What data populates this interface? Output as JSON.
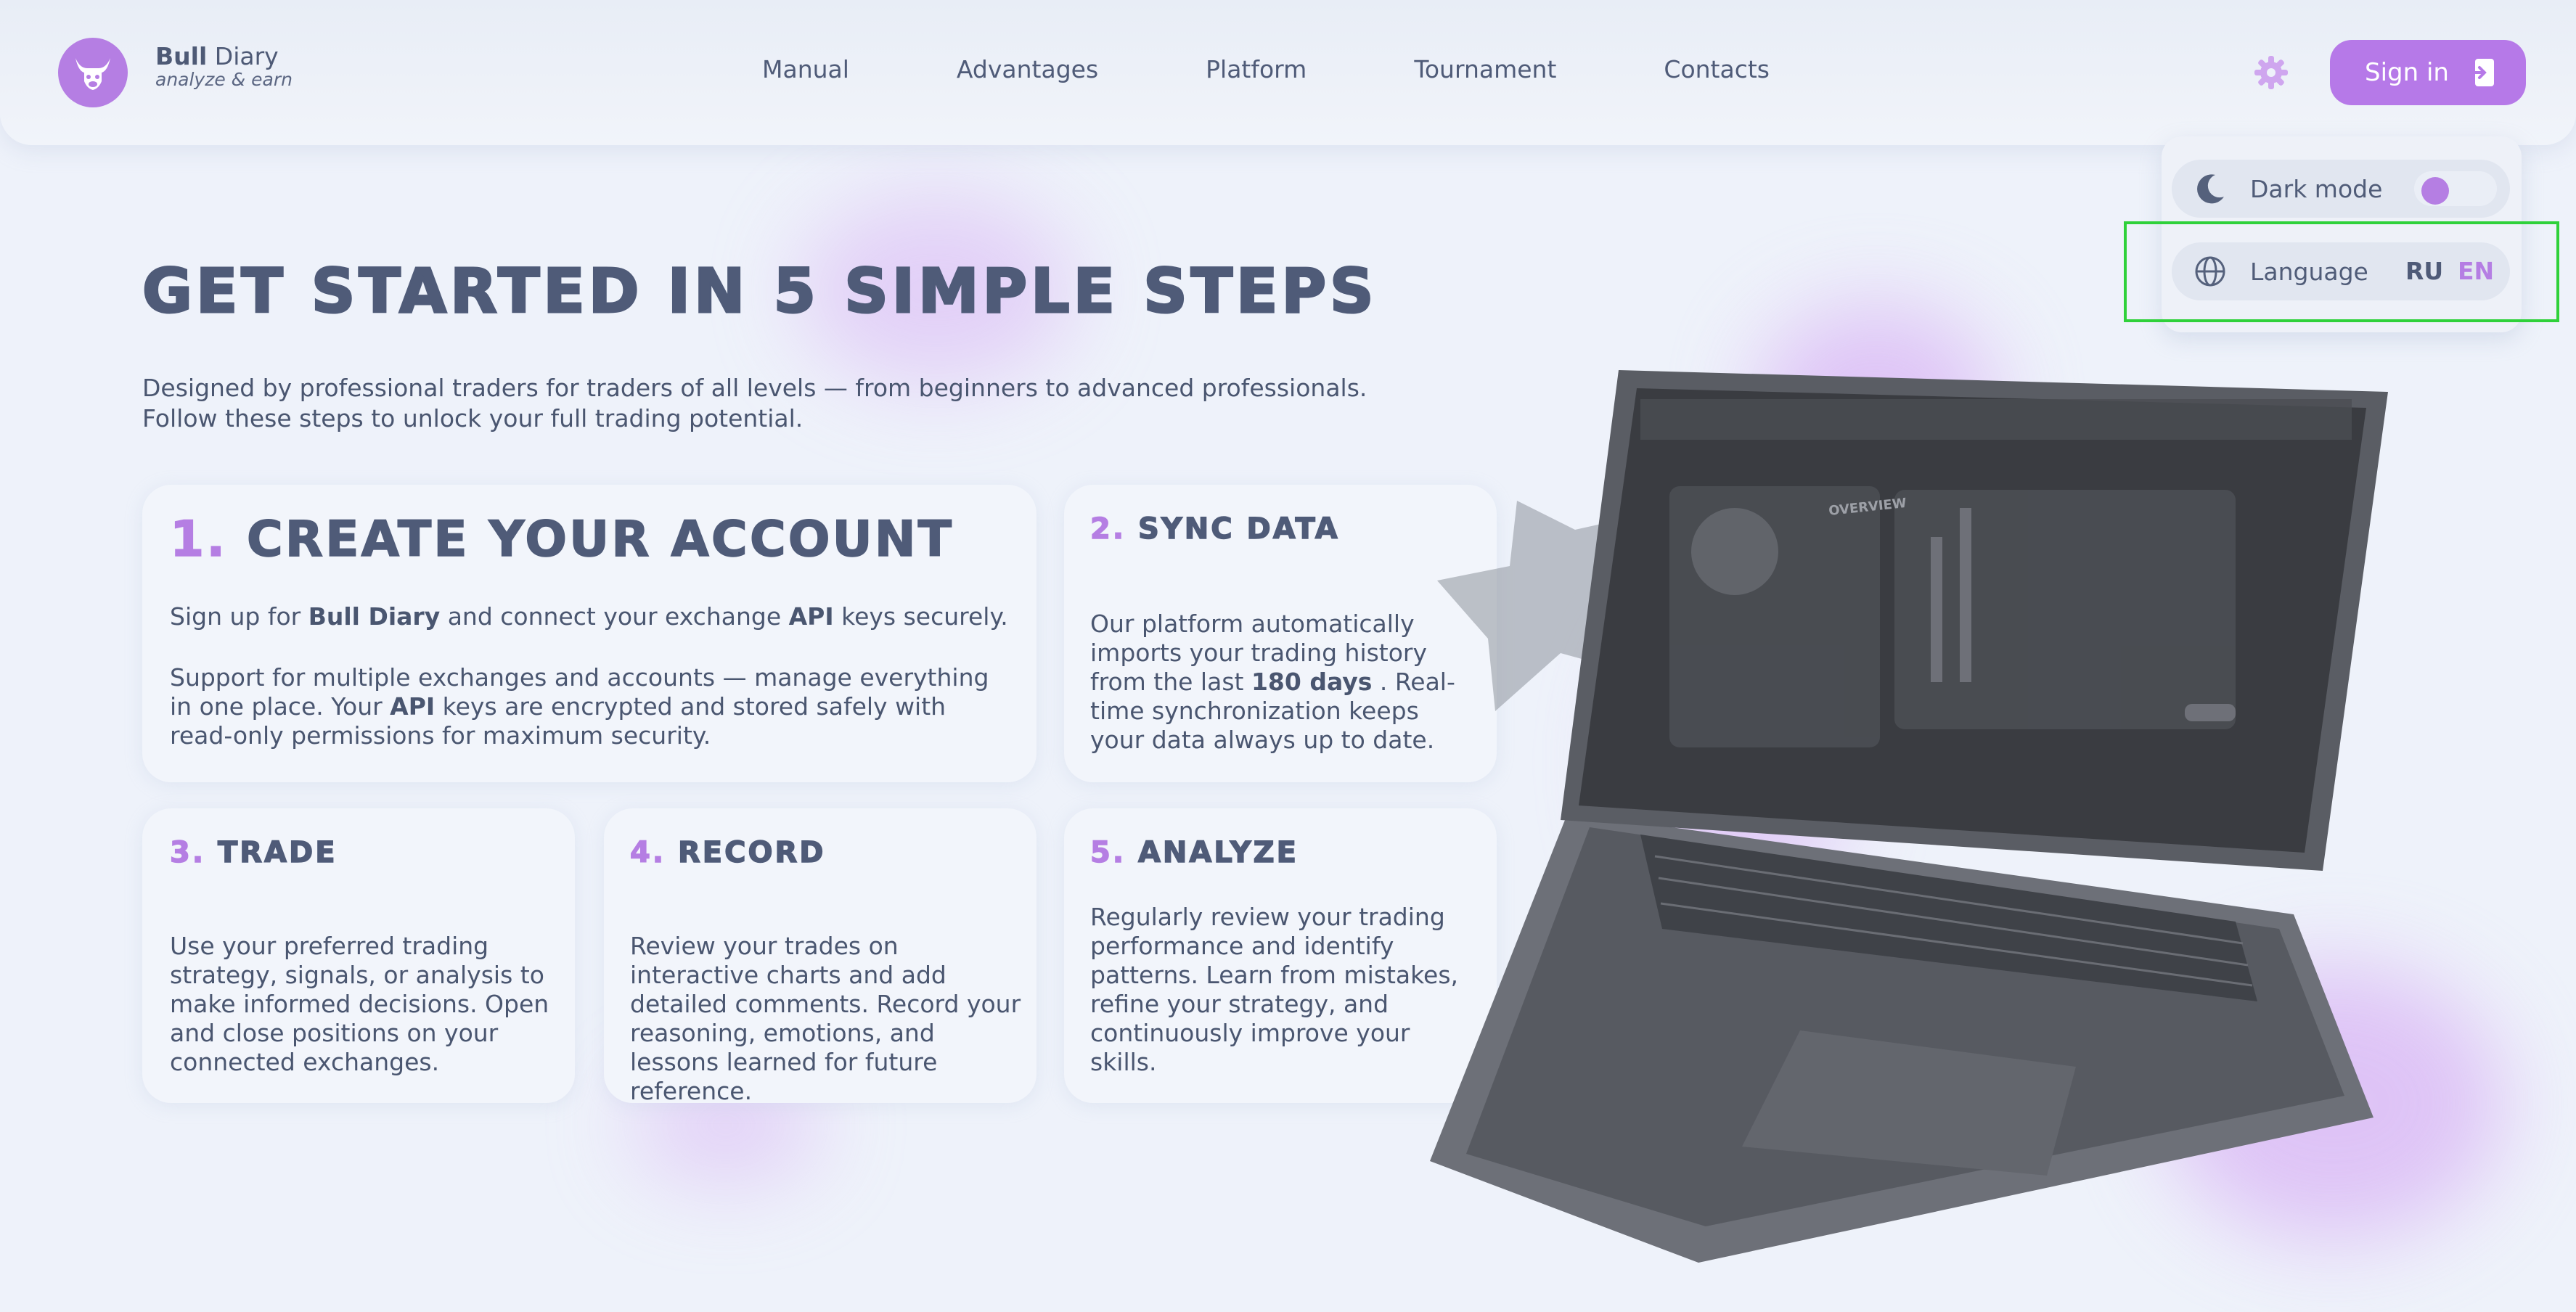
{
  "header": {
    "brand_bold": "Bull",
    "brand_rest": "Diary",
    "tagline": "analyze & earn",
    "nav": [
      "Manual",
      "Advantages",
      "Platform",
      "Tournament",
      "Contacts"
    ],
    "sign_in": "Sign in"
  },
  "settings": {
    "dark_mode_label": "Dark mode",
    "dark_mode_on": true,
    "language_label": "Language",
    "lang_ru": "RU",
    "lang_en": "EN",
    "active_language": "EN"
  },
  "hero": {
    "title": "GET STARTED IN 5 SIMPLE STEPS",
    "subtitle_line1": "Designed by professional traders for traders of all levels — from beginners to advanced professionals.",
    "subtitle_line2": "Follow these steps to unlock your full trading potential."
  },
  "steps": {
    "s1": {
      "num": "1.",
      "title": "CREATE YOUR ACCOUNT",
      "p1_a": "Sign up for ",
      "p1_b": "Bull Diary",
      "p1_c": " and connect your exchange ",
      "p1_d": "API",
      "p1_e": " keys securely.",
      "p2_a": "Support for multiple exchanges and accounts — manage everything in one place. Your ",
      "p2_b": "API",
      "p2_c": " keys are encrypted and stored safely with read-only permissions for maximum security."
    },
    "s2": {
      "num": "2.",
      "title": "SYNC DATA",
      "t_a": "Our platform automatically imports your trading history from the last ",
      "t_b": "180 days",
      "t_c": " . Real-time synchronization keeps your data always up to date."
    },
    "s3": {
      "num": "3.",
      "title": "TRADE",
      "text": "Use your preferred trading strategy, signals, or analysis to make informed decisions. Open and close positions on your connected exchanges."
    },
    "s4": {
      "num": "4.",
      "title": "RECORD",
      "text": "Review your trades on interactive charts and add detailed comments. Record your reasoning, emotions, and lessons learned for future reference."
    },
    "s5": {
      "num": "5.",
      "title": "ANALYZE",
      "text": "Regularly review your trading performance and identify patterns. Learn from mistakes, refine your strategy, and continuously improve your skills."
    }
  },
  "laptop_screen": {
    "heading": "OVERVIEW"
  },
  "colors": {
    "accent": "#b57ee3",
    "text": "#4f5b78",
    "background": "#eef2fa",
    "highlight_box": "#2fd13a"
  }
}
